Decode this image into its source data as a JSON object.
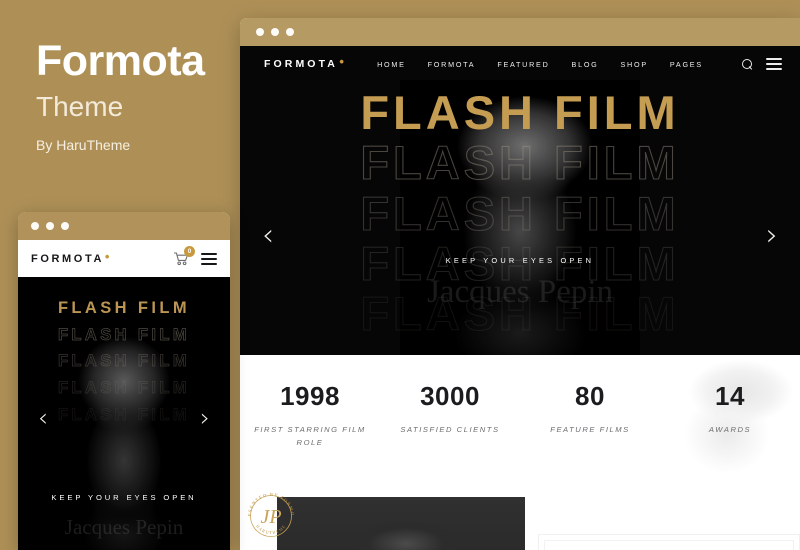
{
  "promo": {
    "title": "Formota",
    "subtitle": "Theme",
    "author": "By HaruTheme"
  },
  "colors": {
    "background": "#ae9057",
    "gold": "#c79a3f",
    "hero_gold": "#c49c52",
    "dark": "#060607",
    "white": "#ffffff"
  },
  "desktop": {
    "titlebar": {
      "dots": [
        "dot-1",
        "dot-2",
        "dot-3"
      ]
    },
    "logo": {
      "text": "FORMOTA",
      "mark": "•"
    },
    "menu": [
      {
        "label": "HOME"
      },
      {
        "label": "FORMOTA"
      },
      {
        "label": "FEATURED"
      },
      {
        "label": "BLOG"
      },
      {
        "label": "SHOP"
      },
      {
        "label": "PAGES"
      }
    ],
    "tools": {
      "search": "search-icon",
      "menu": "hamburger-icon"
    },
    "hero": {
      "headline": "FLASH FILM",
      "repeats": [
        "FLASH FILM",
        "FLASH FILM",
        "FLASH FILM",
        "FLASH FILM",
        "FLASH FILM"
      ],
      "tagline": "KEEP YOUR EYES OPEN",
      "name": "Jacques Pepin",
      "prev": "‹",
      "next": "›"
    },
    "stats": [
      {
        "number": "1998",
        "label": "FIRST STARRING FILM ROLE"
      },
      {
        "number": "3000",
        "label": "SATISFIED CLIENTS"
      },
      {
        "number": "80",
        "label": "FEATURE FILMS"
      },
      {
        "number": "14",
        "label": "AWARDS"
      }
    ],
    "seal": {
      "monogram": "JP",
      "top_text": "PRESENTED BY FORMOTA",
      "bottom_text": "HARUTHEME"
    }
  },
  "mobile": {
    "titlebar": {
      "dots": [
        "dot-1",
        "dot-2",
        "dot-3"
      ]
    },
    "logo": {
      "text": "FORMOTA",
      "mark": "•"
    },
    "cart": {
      "count": "0"
    },
    "menu_icon": "hamburger-icon",
    "hero": {
      "headline": "FLASH FILM",
      "repeats": [
        "FLASH FILM",
        "FLASH FILM",
        "FLASH FILM",
        "FLASH FILM",
        "FLASH FILM"
      ],
      "tagline": "KEEP YOUR EYES OPEN",
      "name": "Jacques Pepin",
      "prev": "‹",
      "next": "›"
    }
  }
}
